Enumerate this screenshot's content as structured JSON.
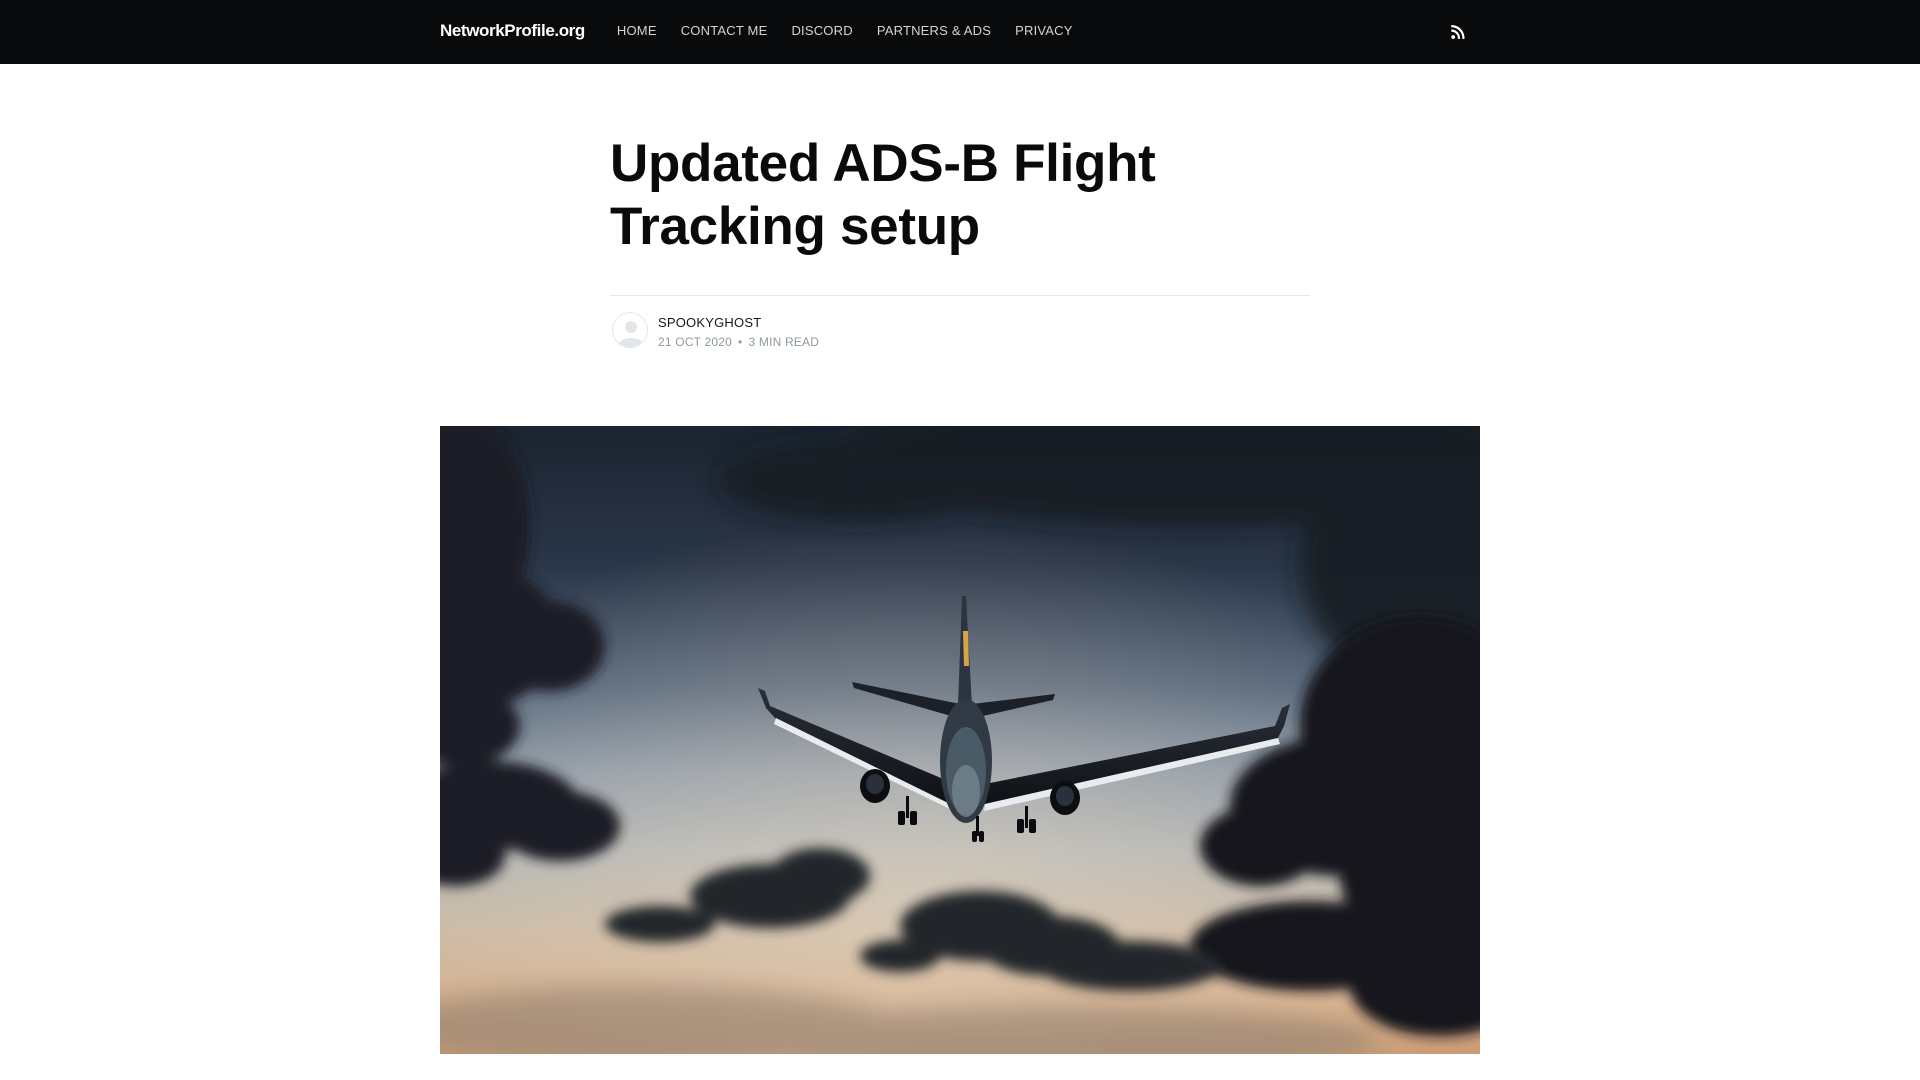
{
  "nav": {
    "brand": "NetworkProfile.org",
    "items": [
      {
        "label": "HOME"
      },
      {
        "label": "CONTACT ME"
      },
      {
        "label": "DISCORD"
      },
      {
        "label": "PARTNERS & ADS"
      },
      {
        "label": "PRIVACY"
      }
    ],
    "rss_icon": "rss-icon"
  },
  "post": {
    "title": "Updated ADS-B Flight Tracking setup",
    "author": "SPOOKYGHOST",
    "date": "21 OCT 2020",
    "separator": "•",
    "reading_time": "3 MIN READ",
    "avatar_icon": "user-avatar-icon",
    "feature_image": "airplane-landing-at-dusk-photo"
  },
  "colors": {
    "nav_background": "#090a0b",
    "title": "#090a0b",
    "meta": "#8f9aa2"
  }
}
